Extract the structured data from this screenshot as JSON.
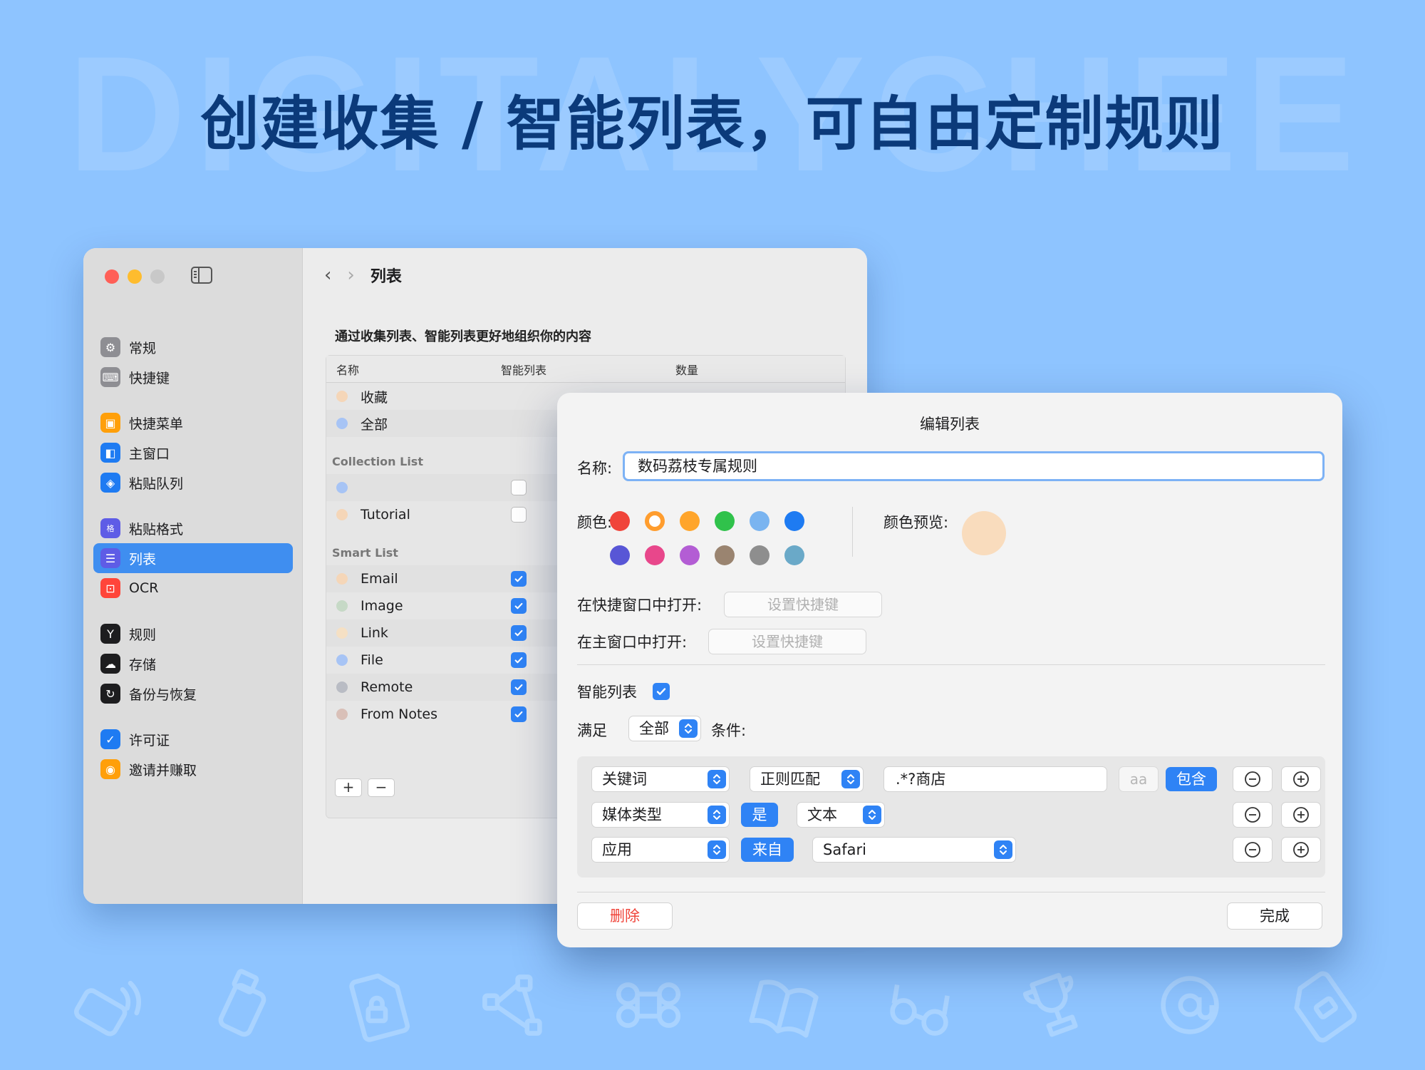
{
  "banner": {
    "watermark": "DIGITALYCHEE",
    "headline": "创建收集 / 智能列表，可自由定制规则"
  },
  "decor_icons": [
    "keyboard-icon",
    "usb-drive-icon",
    "locked-document-icon",
    "vector-path-icon",
    "command-key-icon",
    "book-icon",
    "glasses-icon",
    "trophy-icon",
    "at-sign-icon",
    "sd-card-icon"
  ],
  "window": {
    "sidebar": {
      "traffic_colors": [
        "#ff5f57",
        "#febc2e",
        "#c8c8c8"
      ],
      "items": [
        {
          "label": "常规",
          "icon": "gear-icon",
          "color": "#8e8e93",
          "group": 1
        },
        {
          "label": "快捷键",
          "icon": "keyboard-icon",
          "color": "#8e8e93",
          "group": 1
        },
        {
          "label": "快捷菜单",
          "icon": "quick-menu-icon",
          "color": "#ff9f0a",
          "group": 2
        },
        {
          "label": "主窗口",
          "icon": "main-window-icon",
          "color": "#1e7bf2",
          "group": 2
        },
        {
          "label": "粘贴队列",
          "icon": "stack-icon",
          "color": "#1e7bf2",
          "group": 2
        },
        {
          "label": "粘贴格式",
          "icon": "format-icon",
          "color": "#5e5ce6",
          "group": 3
        },
        {
          "label": "列表",
          "icon": "list-icon",
          "color": "#5e5ce6",
          "group": 3,
          "active": true
        },
        {
          "label": "OCR",
          "icon": "ocr-icon",
          "color": "#ff453a",
          "group": 3
        },
        {
          "label": "规则",
          "icon": "rule-fork-icon",
          "color": "#1d1d1f",
          "group": 4
        },
        {
          "label": "存储",
          "icon": "cloud-icon",
          "color": "#1d1d1f",
          "group": 4
        },
        {
          "label": "备份与恢复",
          "icon": "backup-icon",
          "color": "#1d1d1f",
          "group": 4
        },
        {
          "label": "许可证",
          "icon": "license-badge-icon",
          "color": "#1e7bf2",
          "group": 5
        },
        {
          "label": "邀请并赚取",
          "icon": "invite-people-icon",
          "color": "#ff9f0a",
          "group": 5
        }
      ]
    },
    "main": {
      "title": "列表",
      "description": "通过收集列表、智能列表更好地组织你的内容",
      "columns": [
        "名称",
        "智能列表",
        "数量"
      ],
      "builtin": [
        {
          "name": "收藏",
          "color": "#f5d6b8"
        },
        {
          "name": "全部",
          "color": "#a7c4f5"
        }
      ],
      "collection_section": "Collection List",
      "collection": [
        {
          "name": "",
          "color": "#a7c4f5",
          "smart": false
        },
        {
          "name": "Tutorial",
          "color": "#f5d6b8",
          "smart": false
        }
      ],
      "smart_section": "Smart List",
      "smart": [
        {
          "name": "Email",
          "color": "#f5d6b8",
          "smart": true
        },
        {
          "name": "Image",
          "color": "#c6d9c6",
          "smart": true
        },
        {
          "name": "Link",
          "color": "#f5e0c4",
          "smart": true
        },
        {
          "name": "File",
          "color": "#a7c4f5",
          "smart": true
        },
        {
          "name": "Remote",
          "color": "#b9bcc4",
          "smart": true
        },
        {
          "name": "From Notes",
          "color": "#d9c0b8",
          "smart": true
        }
      ],
      "add_label": "+",
      "remove_label": "−"
    }
  },
  "dialog": {
    "title": "编辑列表",
    "name_label": "名称:",
    "name_value": "数码荔枝专属规则",
    "color_label": "颜色:",
    "colors_row1": [
      "#f0443a",
      "#ff9d2e",
      "#ffa52b",
      "#30c24b",
      "#7ab4f0",
      "#1e7bf2"
    ],
    "colors_row2": [
      "#5856d6",
      "#e8478b",
      "#b35dd4",
      "#9a8470",
      "#8e8e8e",
      "#6aa9c8"
    ],
    "selected_color": "#ff9d2e",
    "preview_label": "颜色预览:",
    "preview_color": "#f9dcbd",
    "quick_open_label": "在快捷窗口中打开:",
    "main_open_label": "在主窗口中打开:",
    "shortcut_placeholder": "设置快捷键",
    "smart_label": "智能列表",
    "smart_checked": true,
    "satisfy_label": "满足",
    "satisfy_value": "全部",
    "condition_label": "条件:",
    "rules": [
      {
        "field": "关键词",
        "op": "正则匹配",
        "value": ".*?商店",
        "case": "aa",
        "mode": "包含"
      },
      {
        "field": "媒体类型",
        "op": "是",
        "value": "文本"
      },
      {
        "field": "应用",
        "op": "来自",
        "value": "Safari"
      }
    ],
    "delete_label": "删除",
    "done_label": "完成"
  }
}
